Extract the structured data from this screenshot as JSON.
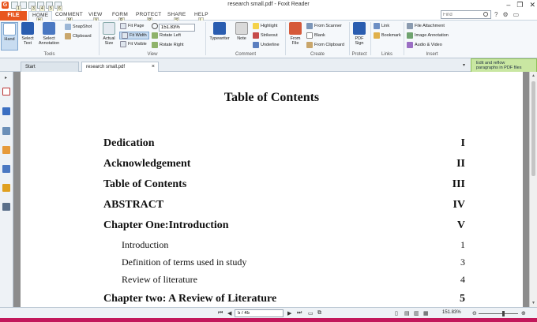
{
  "window": {
    "title": "research small.pdf - Foxit Reader"
  },
  "qat": {
    "keytips": [
      "1",
      "3",
      "4",
      "5",
      "6"
    ]
  },
  "tabs": {
    "file": "FILE",
    "items": [
      {
        "label": "HOME",
        "key": "H"
      },
      {
        "label": "COMMENT",
        "key": "M"
      },
      {
        "label": "VIEW",
        "key": "V"
      },
      {
        "label": "FORM",
        "key": "R"
      },
      {
        "label": "PROTECT",
        "key": "P"
      },
      {
        "label": "SHARE",
        "key": "S"
      },
      {
        "label": "HELP",
        "key": "L"
      }
    ]
  },
  "search": {
    "placeholder": "Find"
  },
  "ribbon": {
    "tools": {
      "label": "Tools",
      "hand": "Hand",
      "select_text": "Select Text",
      "select_annotation": "Select Annotation",
      "snapshot": "SnapShot",
      "clipboard": "Clipboard"
    },
    "view": {
      "label": "View",
      "actual_size": "Actual Size",
      "fit_page": "Fit Page",
      "fit_width": "Fit Width",
      "fit_visible": "Fit Visible",
      "zoom": "151.83%",
      "rotate_left": "Rotate Left",
      "rotate_right": "Rotate Right"
    },
    "comment": {
      "label": "Comment",
      "typewriter": "Typewriter",
      "note": "Note",
      "highlight": "Highlight",
      "strikeout": "Strikeout",
      "underline": "Underline"
    },
    "create": {
      "label": "Create",
      "from_file": "From File",
      "from_scanner": "From Scanner",
      "blank": "Blank",
      "from_clipboard": "From Clipboard"
    },
    "protect": {
      "label": "Protect",
      "pdf_sign": "PDF Sign"
    },
    "links": {
      "label": "Links",
      "link": "Link",
      "bookmark": "Bookmark"
    },
    "insert": {
      "label": "Insert",
      "file_attachment": "File Attachment",
      "image_annotation": "Image Annotation",
      "audio_video": "Audio & Video"
    }
  },
  "doc_tabs": [
    {
      "label": "Start"
    },
    {
      "label": "research small.pdf",
      "close": "×"
    }
  ],
  "promo": {
    "text1": "Edit and reflow",
    "text2": "paragraphs in PDF files"
  },
  "document": {
    "title": "Table of Contents",
    "entries": [
      {
        "label": "Dedication",
        "page": "I",
        "level": "major"
      },
      {
        "label": "Acknowledgement",
        "page": "II",
        "level": "major"
      },
      {
        "label": "Table of Contents",
        "page": "III",
        "level": "major"
      },
      {
        "label": "ABSTRACT",
        "page": "IV",
        "level": "major"
      },
      {
        "label": "Chapter One:Introduction",
        "page": "V",
        "level": "major"
      },
      {
        "label": "Introduction",
        "page": "1",
        "level": "minor"
      },
      {
        "label": "Definition of terms used in study",
        "page": "3",
        "level": "minor"
      },
      {
        "label": "Review of literature",
        "page": "4",
        "level": "minor"
      },
      {
        "label": "Chapter two: A Review of Literature",
        "page": "5",
        "level": "major"
      }
    ]
  },
  "statusbar": {
    "page": "5 / 45",
    "zoom": "151.83%"
  },
  "colors": {
    "accent": "#e8561f",
    "ribbon_bg": "#f5f8fb",
    "selected": "#c8dcf1",
    "promo": "#c9e7a2"
  }
}
